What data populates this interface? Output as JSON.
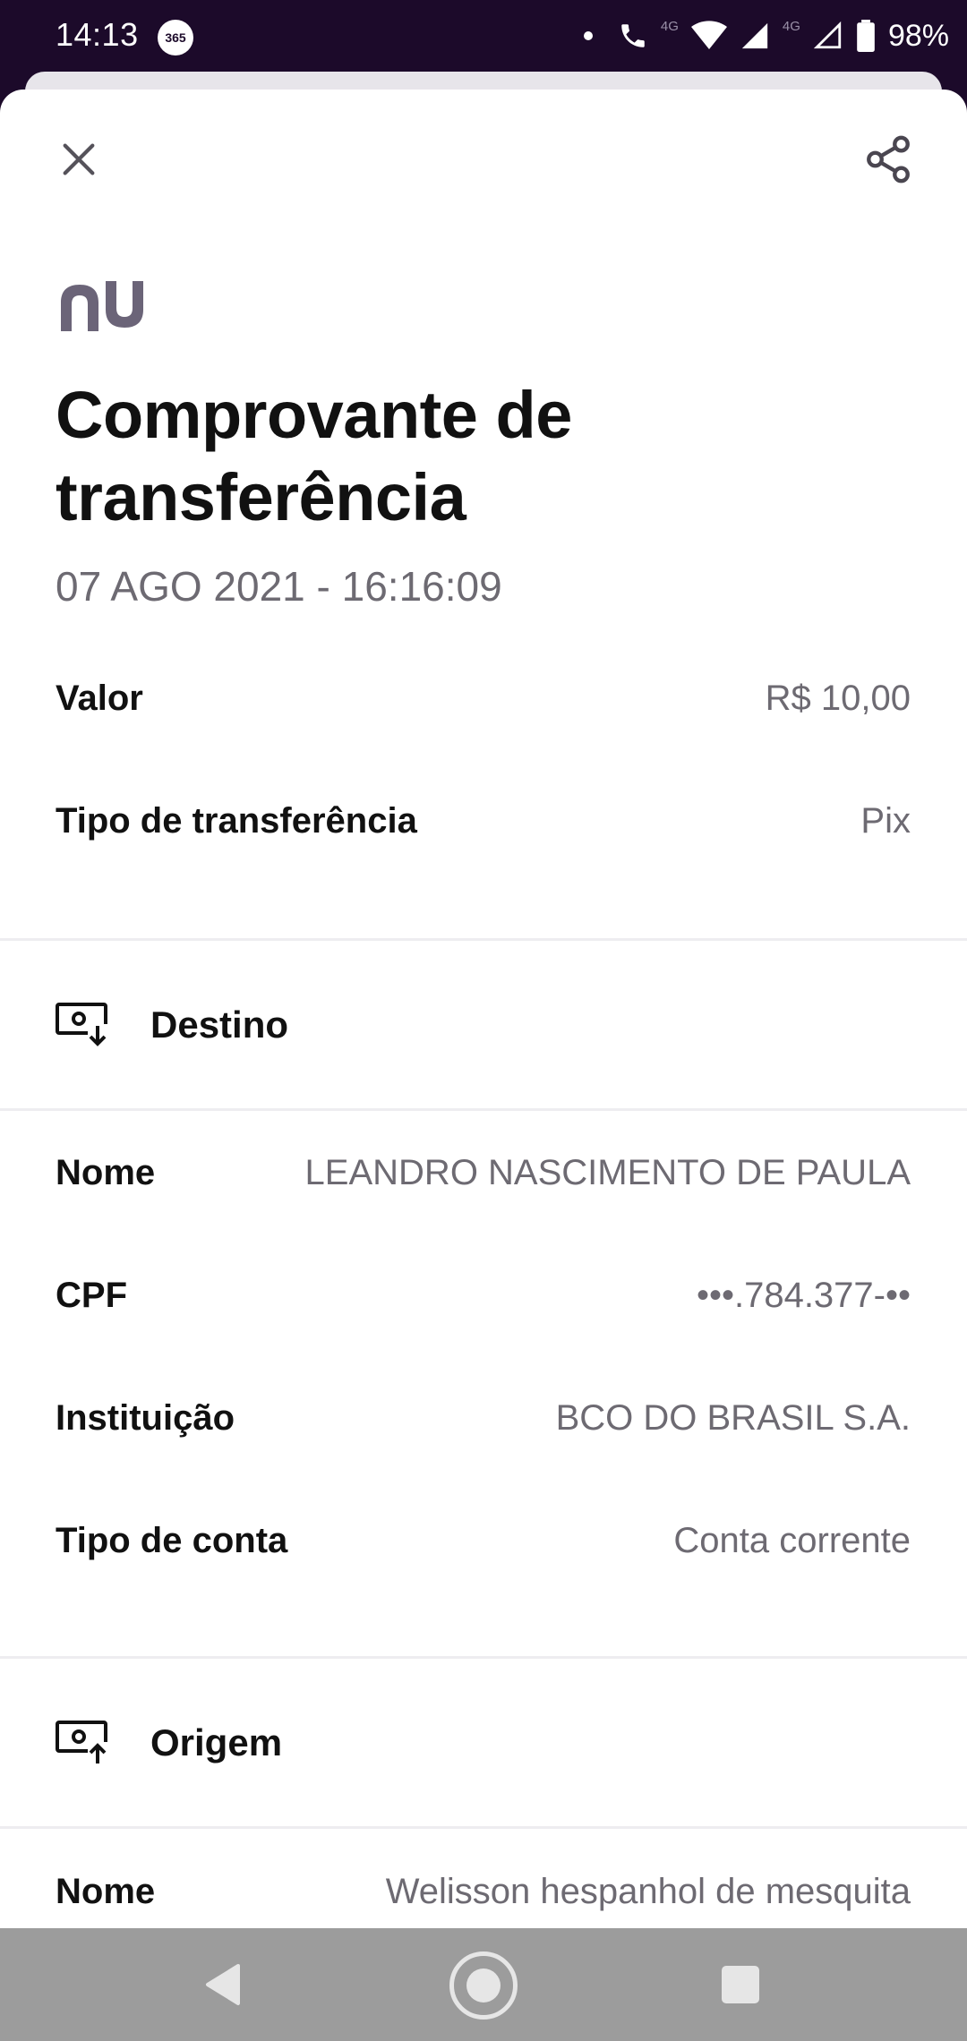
{
  "status_bar": {
    "time": "14:13",
    "app_badge": "365",
    "network_label": "4G",
    "network_label_2": "4G",
    "battery": "98%"
  },
  "header": {
    "close_icon": "close-icon",
    "share_icon": "share-icon"
  },
  "brand": {
    "logo_text": "nu",
    "color": "#6b6478"
  },
  "receipt": {
    "title": "Comprovante de transferência",
    "datetime": "07 AGO 2021 - 16:16:09"
  },
  "summary": [
    {
      "label": "Valor",
      "value": "R$ 10,00"
    },
    {
      "label": "Tipo de transferência",
      "value": "Pix"
    }
  ],
  "destination": {
    "section_label": "Destino",
    "icon": "device-download-icon",
    "rows": [
      {
        "label": "Nome",
        "value": "LEANDRO NASCIMENTO DE PAULA"
      },
      {
        "label": "CPF",
        "value": "•••.784.377-••"
      },
      {
        "label": "Instituição",
        "value": "BCO DO BRASIL S.A."
      },
      {
        "label": "Tipo de conta",
        "value": "Conta corrente"
      }
    ]
  },
  "origin": {
    "section_label": "Origem",
    "icon": "device-upload-icon",
    "rows": [
      {
        "label": "Nome",
        "value": "Welisson hespanhol de mesquita"
      }
    ]
  },
  "colors": {
    "status_bg": "#1c0a2a",
    "text_primary": "#111111",
    "text_secondary": "#6d6a72",
    "nav_bg": "#9c9c9c"
  }
}
